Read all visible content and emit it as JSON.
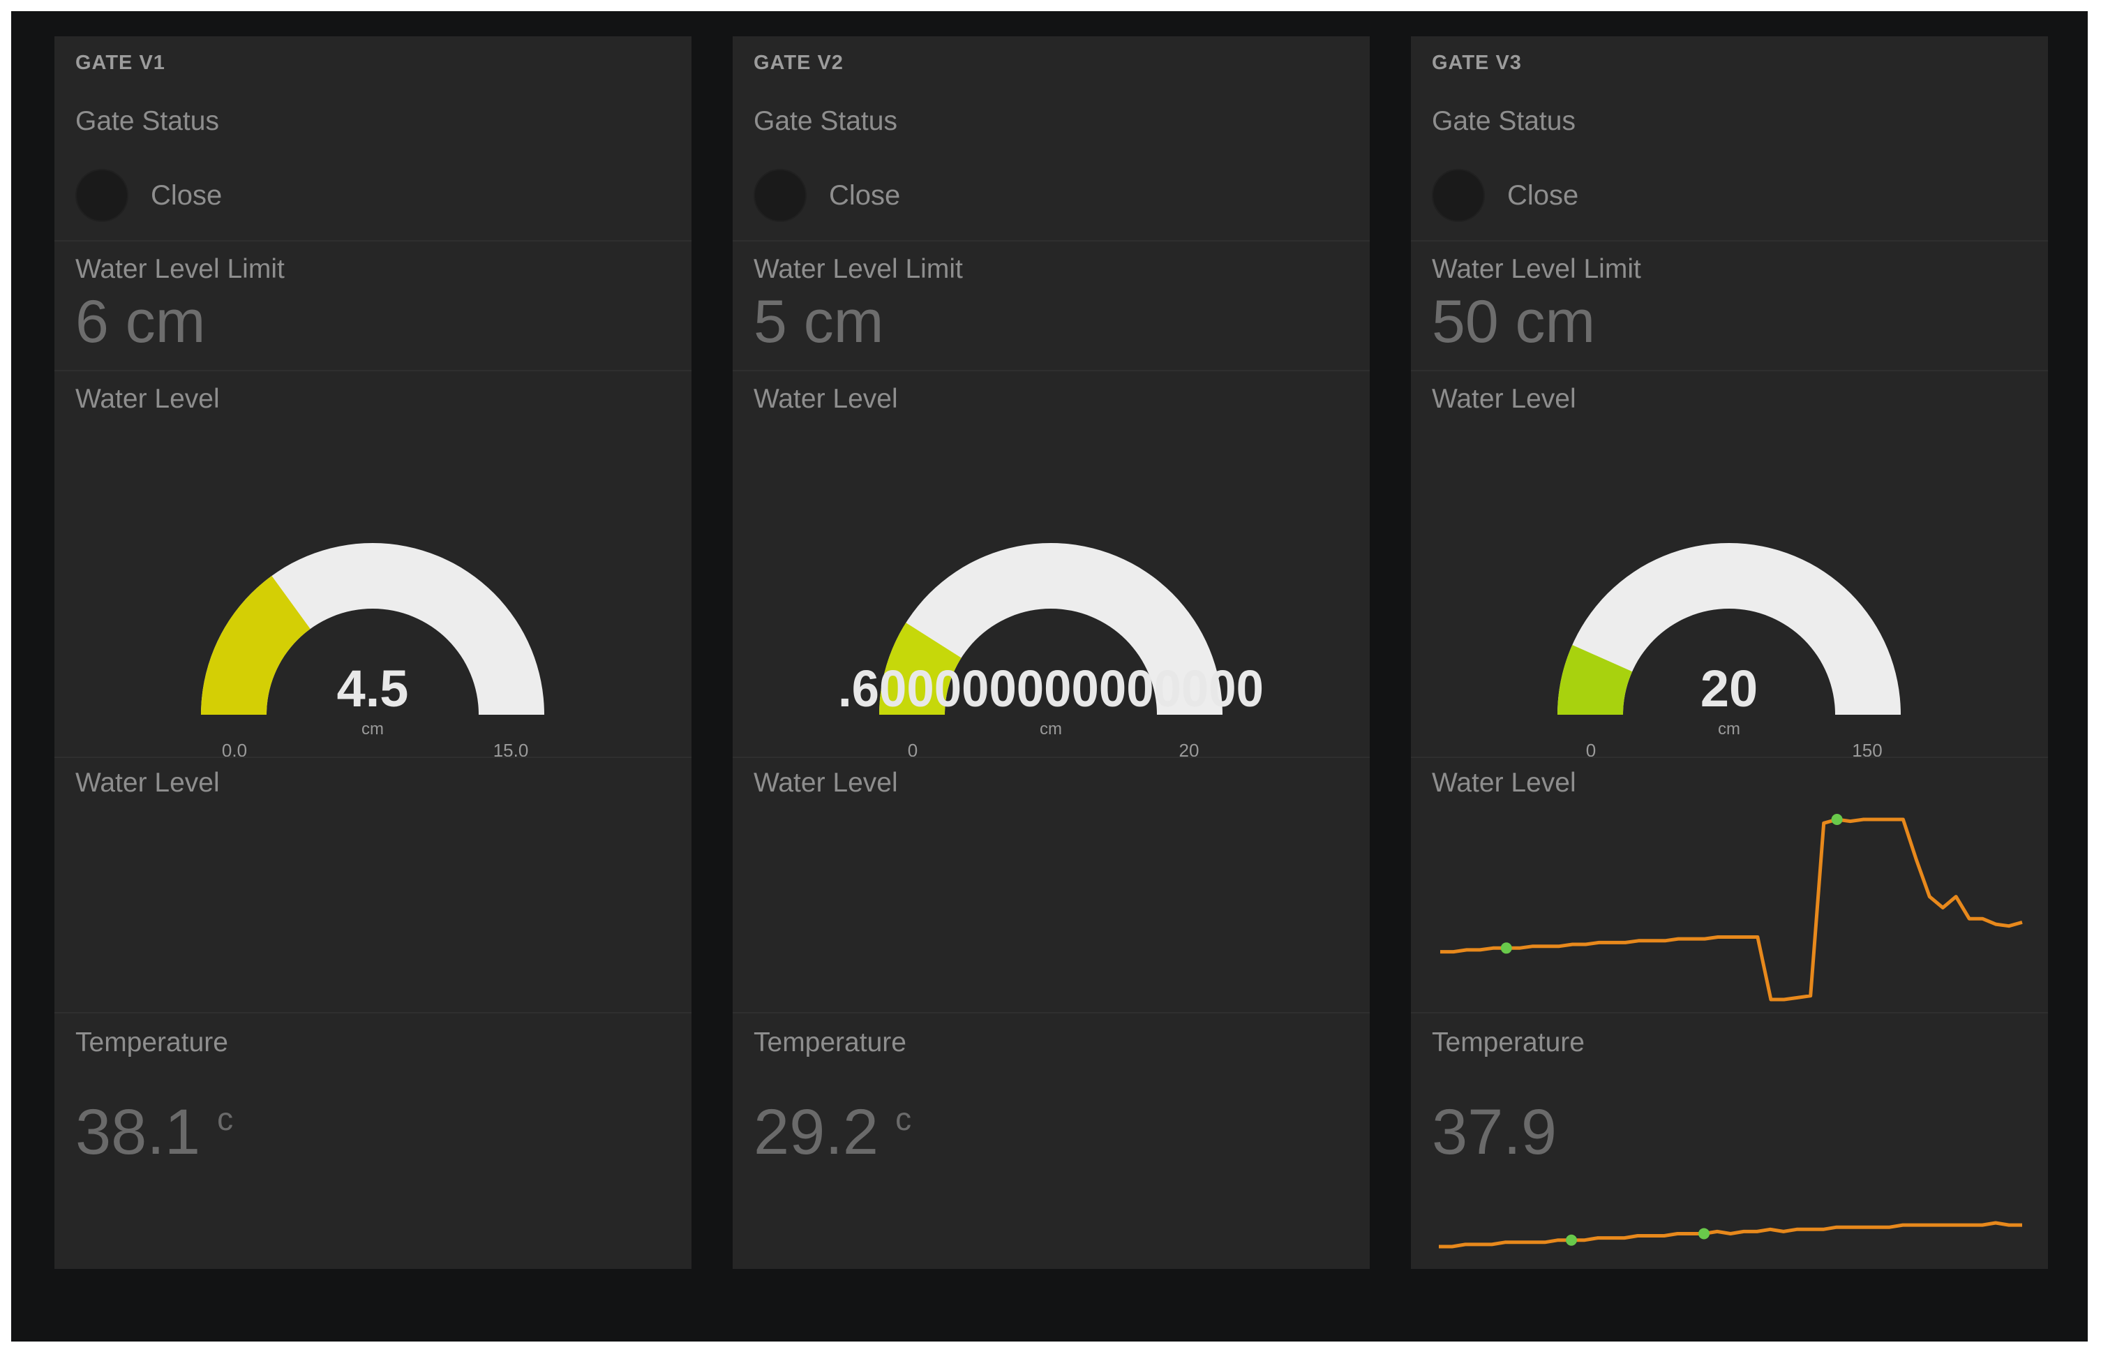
{
  "gates": [
    {
      "title": "GATE V1",
      "status_label": "Gate Status",
      "status_text": "Close",
      "limit_label": "Water Level Limit",
      "limit_value": "6 cm",
      "gauge_label": "Water Level",
      "gauge": {
        "value": 4.5,
        "display": "4.5",
        "unit": "cm",
        "min": 0,
        "max": 15,
        "min_label": "0.0",
        "max_label": "15.0",
        "color": "#d4cf05"
      },
      "chart_label": "Water Level",
      "temp_label": "Temperature",
      "temp_value": "38.1",
      "temp_unit": "c"
    },
    {
      "title": "GATE V2",
      "status_label": "Gate Status",
      "status_text": "Close",
      "limit_label": "Water Level Limit",
      "limit_value": "5 cm",
      "gauge_label": "Water Level",
      "gauge": {
        "value": 3.6,
        "display": ".600000000000000",
        "unit": "cm",
        "min": 0,
        "max": 20,
        "min_label": "0",
        "max_label": "20",
        "color": "#c6d80a"
      },
      "chart_label": "Water Level",
      "temp_label": "Temperature",
      "temp_value": "29.2",
      "temp_unit": "c"
    },
    {
      "title": "GATE V3",
      "status_label": "Gate Status",
      "status_text": "Close",
      "limit_label": "Water Level Limit",
      "limit_value": "50 cm",
      "gauge_label": "Water Level",
      "gauge": {
        "value": 20,
        "display": "20",
        "unit": "cm",
        "min": 0,
        "max": 150,
        "min_label": "0",
        "max_label": "150",
        "color": "#a8d20e"
      },
      "chart_label": "Water Level",
      "temp_label": "Temperature",
      "temp_value": "37.9",
      "temp_unit": ""
    }
  ],
  "chart_data": [
    {
      "type": "line",
      "series": [
        {
          "values": [
            30,
            30,
            31,
            31,
            32,
            32,
            32,
            33,
            33,
            33,
            34,
            34,
            35,
            35,
            35,
            36,
            36,
            36,
            37,
            37,
            37,
            38,
            38,
            38,
            38,
            4,
            4,
            5,
            6,
            100,
            102,
            101,
            102,
            102,
            102,
            102,
            80,
            60,
            54,
            60,
            48,
            48,
            45,
            44,
            46
          ]
        }
      ],
      "markers": [
        5,
        30
      ],
      "color": "#e8891c",
      "marker_color": "#69c94b"
    },
    {
      "type": "line",
      "series": [
        {
          "values": [
            10,
            10,
            11,
            11,
            11,
            12,
            12,
            12,
            12,
            13,
            13,
            13,
            14,
            14,
            14,
            15,
            15,
            15,
            16,
            16,
            16,
            17,
            16,
            17,
            17,
            18,
            17,
            18,
            18,
            18,
            19,
            19,
            19,
            19,
            19,
            20,
            20,
            20,
            20,
            20,
            20,
            20,
            21,
            20,
            20
          ]
        }
      ],
      "markers": [
        10,
        20
      ],
      "color": "#e8891c",
      "marker_color": "#69c94b"
    }
  ]
}
